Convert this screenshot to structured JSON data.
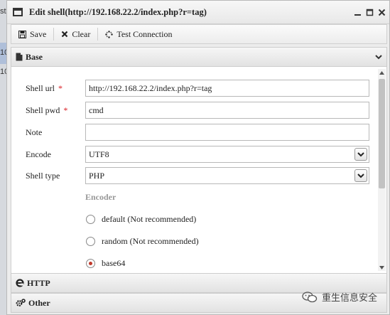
{
  "window": {
    "title": "Edit shell(http://192.168.22.2/index.php?r=tag)"
  },
  "background": {
    "fragments": [
      "st",
      "10",
      "10"
    ]
  },
  "toolbar": {
    "save_label": "Save",
    "clear_label": "Clear",
    "test_label": "Test Connection"
  },
  "sections": {
    "base": "Base",
    "http": "HTTP",
    "other": "Other"
  },
  "form": {
    "shell_url": {
      "label": "Shell url",
      "required_mark": "*",
      "value": "http://192.168.22.2/index.php?r=tag"
    },
    "shell_pwd": {
      "label": "Shell pwd",
      "required_mark": "*",
      "value": "cmd"
    },
    "note": {
      "label": "Note",
      "value": ""
    },
    "encode": {
      "label": "Encode",
      "value": "UTF8"
    },
    "shell_type": {
      "label": "Shell type",
      "value": "PHP"
    },
    "encoder": {
      "legend": "Encoder",
      "options": [
        "default (Not recommended)",
        "random (Not recommended)",
        "base64"
      ],
      "selected": "base64"
    }
  },
  "watermark": {
    "text": "重生信息安全"
  },
  "colors": {
    "required": "#d9181e",
    "radio_selected": "#c0392b"
  }
}
